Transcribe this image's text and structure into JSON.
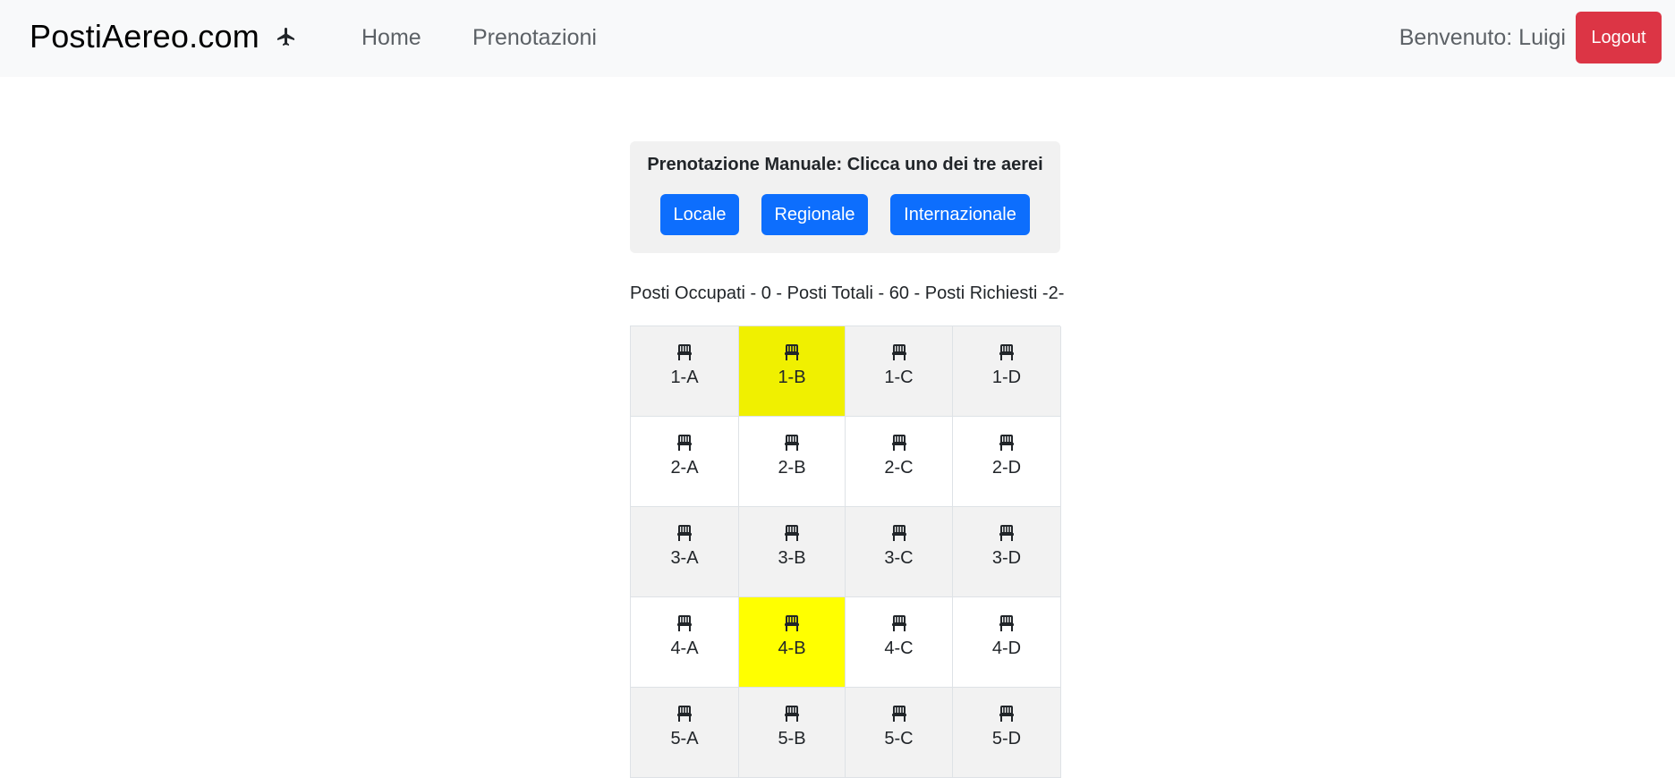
{
  "navbar": {
    "brand": "PostiAereo.com",
    "brand_icon": "airplane-icon",
    "links": [
      "Home",
      "Prenotazioni"
    ],
    "welcome": "Benvenuto: Luigi",
    "logout_label": "Logout"
  },
  "booking": {
    "title": "Prenotazione Manuale: Clicca uno dei tre aerei",
    "buttons": [
      "Locale",
      "Regionale",
      "Internazionale"
    ]
  },
  "status_text": "Posti Occupati - 0 - Posti Totali - 60 - Posti Richiesti -2-",
  "seat_icon": "seat-icon",
  "colors": {
    "primary": "#0d6efd",
    "danger": "#dc3545",
    "selected_seat": "#ffff00"
  },
  "seats": {
    "rows": [
      [
        {
          "label": "1-A"
        },
        {
          "label": "1-B",
          "selected": true
        },
        {
          "label": "1-C"
        },
        {
          "label": "1-D"
        }
      ],
      [
        {
          "label": "2-A"
        },
        {
          "label": "2-B"
        },
        {
          "label": "2-C"
        },
        {
          "label": "2-D"
        }
      ],
      [
        {
          "label": "3-A"
        },
        {
          "label": "3-B"
        },
        {
          "label": "3-C"
        },
        {
          "label": "3-D"
        }
      ],
      [
        {
          "label": "4-A"
        },
        {
          "label": "4-B",
          "selected": true
        },
        {
          "label": "4-C"
        },
        {
          "label": "4-D"
        }
      ],
      [
        {
          "label": "5-A"
        },
        {
          "label": "5-B"
        },
        {
          "label": "5-C"
        },
        {
          "label": "5-D"
        }
      ]
    ]
  }
}
